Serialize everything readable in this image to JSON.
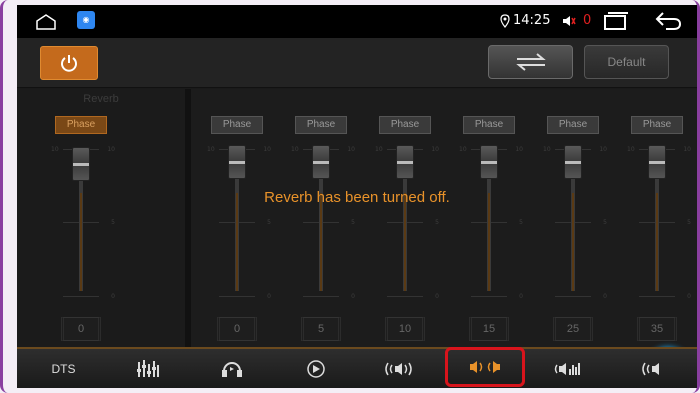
{
  "status_bar": {
    "time": "14:25",
    "volume_count": "0"
  },
  "top_bar": {
    "default_label": "Default"
  },
  "reverb": {
    "label": "Reverb"
  },
  "toast": "Reverb has been turned off.",
  "channels": [
    {
      "phase": "Phase",
      "scale_top": "10",
      "scale_top_r": "10",
      "scale_mid": "5",
      "scale_bot": "0",
      "value": "0"
    },
    {
      "phase": "Phase",
      "scale_top": "10",
      "scale_top_r": "10",
      "scale_mid": "5",
      "scale_bot": "0",
      "value": "0"
    },
    {
      "phase": "Phase",
      "scale_top": "10",
      "scale_top_r": "10",
      "scale_mid": "5",
      "scale_bot": "0",
      "value": "5"
    },
    {
      "phase": "Phase",
      "scale_top": "10",
      "scale_top_r": "10",
      "scale_mid": "5",
      "scale_bot": "0",
      "value": "10"
    },
    {
      "phase": "Phase",
      "scale_top": "10",
      "scale_top_r": "10",
      "scale_mid": "5",
      "scale_bot": "0",
      "value": "15"
    },
    {
      "phase": "Phase",
      "scale_top": "10",
      "scale_top_r": "10",
      "scale_mid": "5",
      "scale_bot": "0",
      "value": "25"
    },
    {
      "phase": "Phase",
      "scale_top": "10",
      "scale_top_r": "10",
      "scale_mid": "5",
      "scale_bot": "0",
      "value": "35"
    }
  ],
  "bottom_tabs": [
    {
      "label": "DTS",
      "icon": "dts-text"
    },
    {
      "label": "",
      "icon": "equalizer-icon"
    },
    {
      "label": "",
      "icon": "headphone-surround-icon"
    },
    {
      "label": "",
      "icon": "speaker-play-icon"
    },
    {
      "label": "",
      "icon": "surround-sound-icon"
    },
    {
      "label": "",
      "icon": "reverb-sound-icon"
    },
    {
      "label": "",
      "icon": "bass-level-icon"
    },
    {
      "label": "",
      "icon": "stereo-wave-icon"
    }
  ],
  "colors": {
    "accent": "#e8922a",
    "selection": "#d8141c",
    "assist_blue": "#1fa0e0"
  }
}
